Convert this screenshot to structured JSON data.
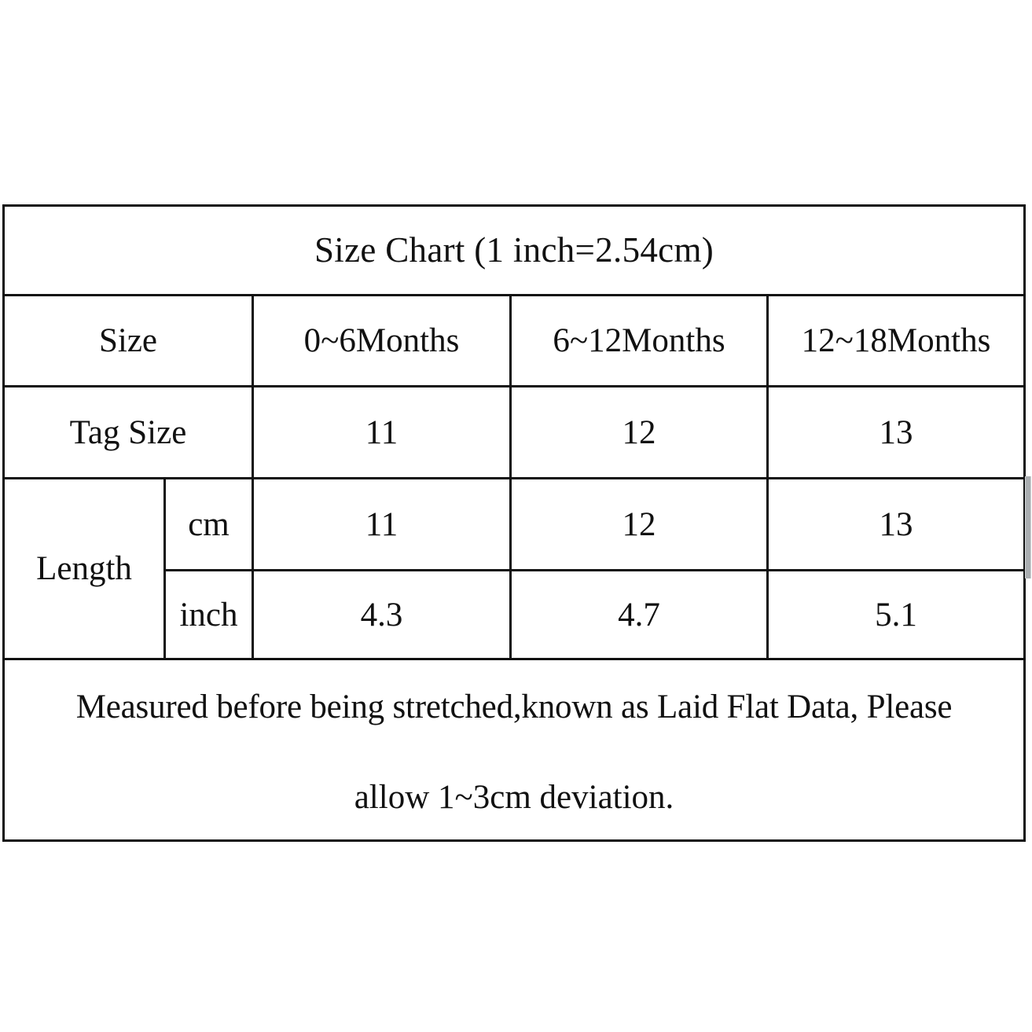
{
  "document": {
    "title": "Size Chart (1 inch=2.54cm)",
    "background_color": "#ffffff",
    "border_color": "#111111",
    "text_color": "#111111"
  },
  "chart_data": {
    "type": "table",
    "title": "Size Chart (1 inch=2.54cm)",
    "columns": [
      "Size",
      "0~6Months",
      "6~12Months",
      "12~18Months"
    ],
    "rows": [
      {
        "label": "Tag Size",
        "unit": "",
        "values": [
          "11",
          "12",
          "13"
        ]
      },
      {
        "label": "Length",
        "unit": "cm",
        "values": [
          "11",
          "12",
          "13"
        ]
      },
      {
        "label": "Length",
        "unit": "inch",
        "values": [
          "4.3",
          "4.7",
          "5.1"
        ]
      }
    ],
    "note": "Measured before being stretched,known as Laid Flat Data, Please allow 1~3cm deviation."
  },
  "table": {
    "title": "Size Chart (1 inch=2.54cm)",
    "header": {
      "size_label": "Size",
      "col_1": "0~6Months",
      "col_2": "6~12Months",
      "col_3": "12~18Months"
    },
    "tag_size": {
      "label": "Tag Size",
      "v1": "11",
      "v2": "12",
      "v3": "13"
    },
    "length": {
      "label": "Length",
      "cm": {
        "unit": "cm",
        "v1": "11",
        "v2": "12",
        "v3": "13"
      },
      "inch": {
        "unit": "inch",
        "v1": "4.3",
        "v2": "4.7",
        "v3": "5.1"
      }
    },
    "note": {
      "line_1": "Measured before being stretched,known as Laid Flat Data, Please",
      "line_2": "allow 1~3cm deviation."
    }
  }
}
